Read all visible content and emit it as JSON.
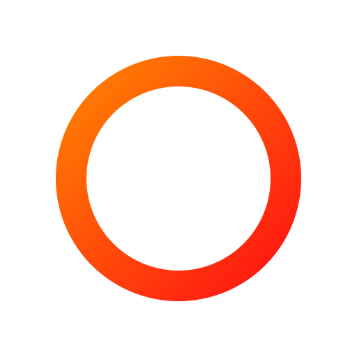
{
  "icon": {
    "name": "ring-icon",
    "gradient_start_color": "#FF8A00",
    "gradient_end_color": "#FF0A14",
    "background_color": "#FFFFFF"
  }
}
